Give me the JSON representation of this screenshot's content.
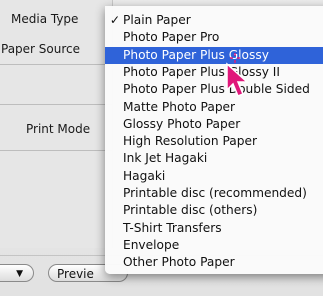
{
  "dialog": {
    "labels": {
      "media_type": "Media Type",
      "paper_source": "Paper Source",
      "print_mode": "Print Mode"
    },
    "buttons": {
      "preview_partial": "Previe"
    }
  },
  "menu": {
    "selected_index": 2,
    "checked_index": 0,
    "check_mark": "✓",
    "items": [
      "Plain Paper",
      "Photo Paper Pro",
      "Photo Paper Plus Glossy",
      "Photo Paper Plus Glossy II",
      "Photo Paper Plus Double Sided",
      "Matte Photo Paper",
      "Glossy Photo Paper",
      "High Resolution Paper",
      "Ink Jet Hagaki",
      "Hagaki",
      "Printable disc (recommended)",
      "Printable disc (others)",
      "T-Shirt Transfers",
      "Envelope",
      "Other Photo Paper"
    ]
  },
  "cursor": {
    "icon": "pointer-arrow-icon",
    "color": "#e0177a"
  },
  "colors": {
    "selection": "#2f63d9"
  }
}
